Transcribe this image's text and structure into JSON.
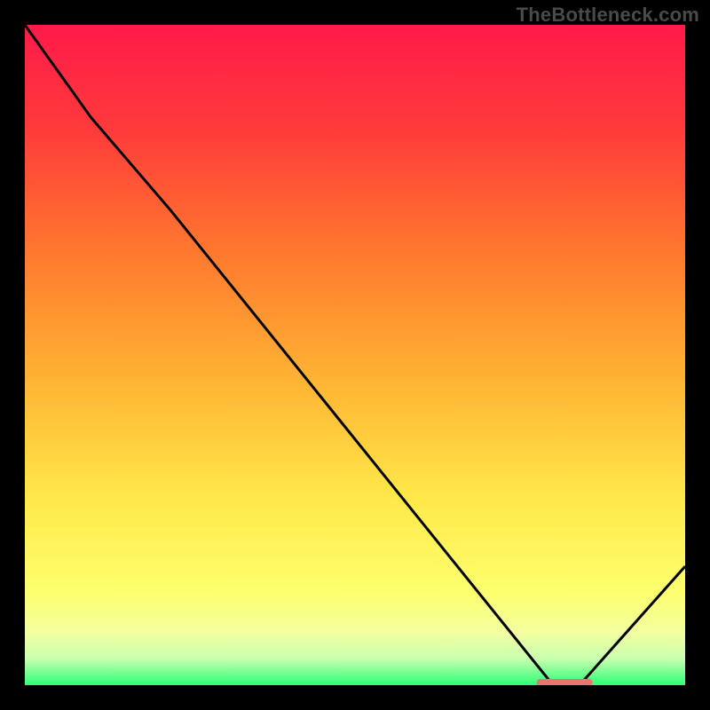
{
  "watermark": "TheBottleneck.com",
  "chart_data": {
    "type": "line",
    "title": "",
    "xlabel": "",
    "ylabel": "",
    "xlim": [
      0,
      100
    ],
    "ylim": [
      0,
      100
    ],
    "grid": false,
    "x": [
      0,
      10,
      22,
      80,
      84,
      100
    ],
    "y": [
      100,
      86,
      72,
      0,
      0,
      18
    ],
    "marker_segment": {
      "x0": 77.5,
      "x1": 86,
      "y": 0.4
    },
    "gradient_stops": [
      {
        "pct": 0,
        "color": "#ff1a4a"
      },
      {
        "pct": 16,
        "color": "#ff3b3b"
      },
      {
        "pct": 35,
        "color": "#ff7a2e"
      },
      {
        "pct": 55,
        "color": "#ffb734"
      },
      {
        "pct": 72,
        "color": "#ffe94a"
      },
      {
        "pct": 86,
        "color": "#fdff6e"
      },
      {
        "pct": 92,
        "color": "#f3ffa0"
      },
      {
        "pct": 96,
        "color": "#c9ffb0"
      },
      {
        "pct": 100,
        "color": "#2eff77"
      }
    ],
    "marker_color": "#e7766f",
    "line_color": "#000000"
  }
}
